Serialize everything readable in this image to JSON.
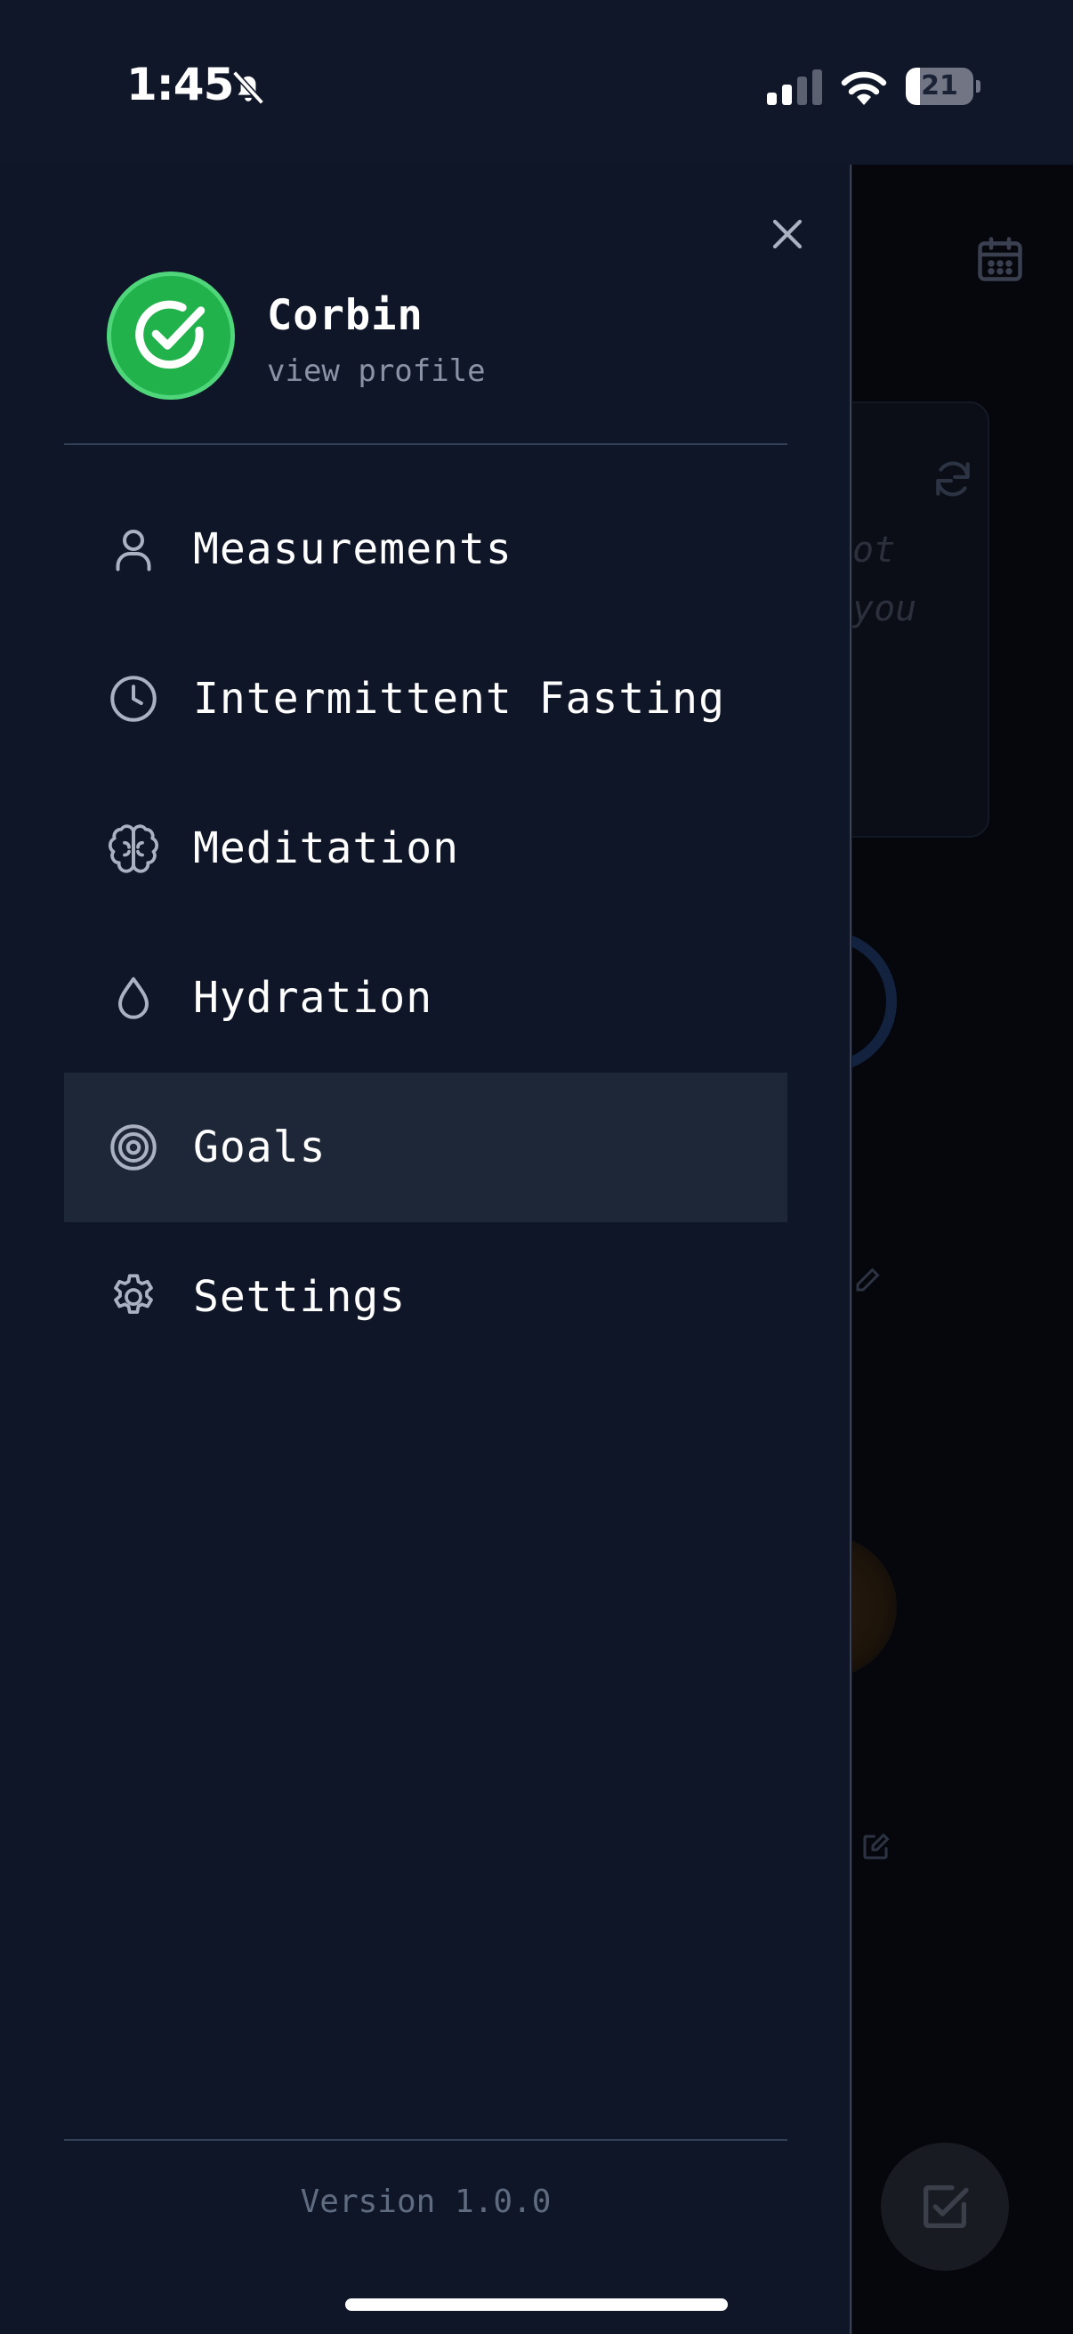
{
  "status_bar": {
    "time": "1:45",
    "battery_level": "21",
    "battery_fraction": 0.21,
    "silent_mode_icon": "bell-off-icon",
    "signal_icon": "cellular-signal-icon",
    "wifi_icon": "wifi-icon"
  },
  "drawer": {
    "close_icon": "close-icon",
    "profile": {
      "name": "Corbin",
      "link": "view profile",
      "avatar_icon": "check-circle-icon",
      "avatar_color": "#22b24c"
    },
    "menu": [
      {
        "label": "Measurements",
        "icon": "person-icon",
        "active": false
      },
      {
        "label": "Intermittent Fasting",
        "icon": "clock-icon",
        "active": false
      },
      {
        "label": "Meditation",
        "icon": "brain-icon",
        "active": false
      },
      {
        "label": "Hydration",
        "icon": "droplet-icon",
        "active": false
      },
      {
        "label": "Goals",
        "icon": "target-icon",
        "active": true
      },
      {
        "label": "Settings",
        "icon": "gear-icon",
        "active": false
      }
    ],
    "version": "Version 1.0.0"
  },
  "background": {
    "quote_fragment_1": "ot",
    "quote_fragment_2": "you"
  },
  "colors": {
    "drawer_background": "#0f1628",
    "active_item_background": "#1d2738",
    "text_primary": "#ffffff",
    "text_secondary": "#8a93a6",
    "accent_green": "#22b24c"
  }
}
